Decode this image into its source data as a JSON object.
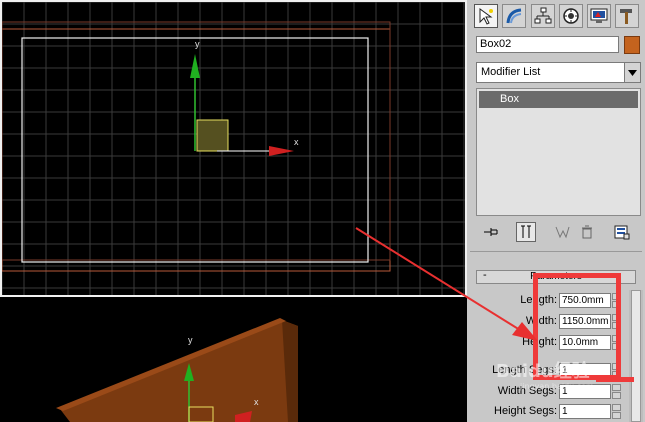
{
  "viewports": {
    "top": {
      "axis_y": "y",
      "axis_x": "x"
    },
    "perspective": {
      "axis_y": "y",
      "axis_x": "x"
    }
  },
  "toolbar": {
    "icons": [
      "select-icon",
      "curve-icon",
      "hierarchy-icon",
      "motion-icon",
      "display-icon",
      "utilities-hammer-icon"
    ]
  },
  "object": {
    "name": "Box02",
    "color": "#c4631e"
  },
  "modifier_list": {
    "label": "Modifier List"
  },
  "stack": {
    "items": [
      "Box"
    ]
  },
  "parameters": {
    "title": "Parameters",
    "collapse_symbol": "-",
    "length_label": "Length:",
    "length_value": "750.0mm",
    "width_label": "Width:",
    "width_value": "1150.0mm",
    "height_label": "Height:",
    "height_value": "10.0mm",
    "length_segs_label": "Length Segs:",
    "length_segs_value": "1",
    "width_segs_label": "Width Segs:",
    "width_segs_value": "1",
    "height_segs_label": "Height Segs:",
    "height_segs_value": "1"
  },
  "watermark": {
    "main": "Baidu经验",
    "sub": "jingyan.baidu.com"
  },
  "colors": {
    "highlight": "#ef3a3a",
    "grid": "#3a3a3a",
    "box": "#8b4513"
  }
}
